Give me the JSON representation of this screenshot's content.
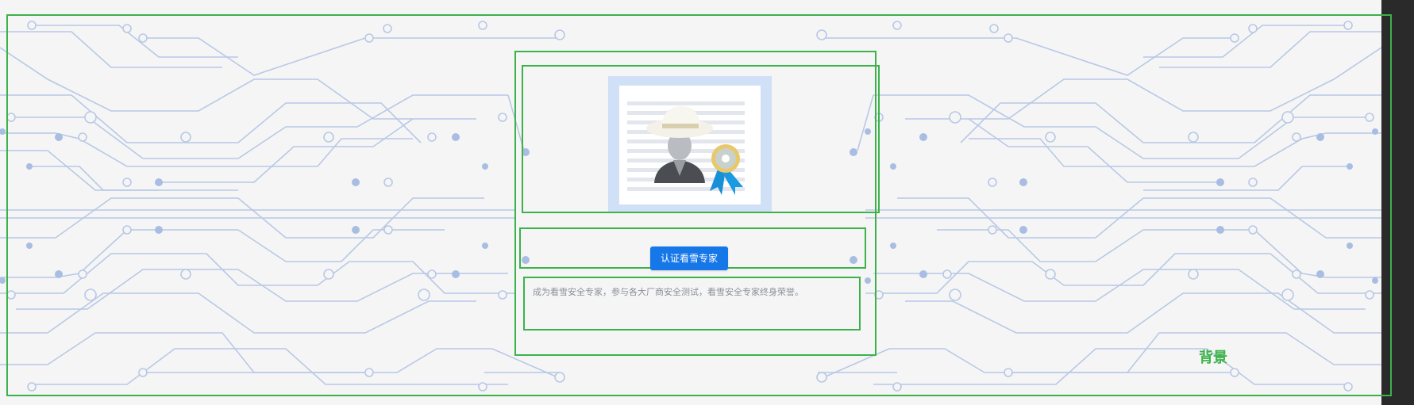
{
  "background": {
    "label": "背景",
    "theme_colors": {
      "trace": "#b8c8e6",
      "node": "#a9bde2",
      "canvas": "#f5f5f5",
      "outline": "#3bb24a"
    }
  },
  "card": {
    "image_icon": "certified-expert-hacker-icon",
    "button_label": "认证看雪专家",
    "button_color": "#1677e8",
    "description": "成为看雪安全专家，参与各大厂商安全测试，看雪安全专家终身荣誉。"
  }
}
